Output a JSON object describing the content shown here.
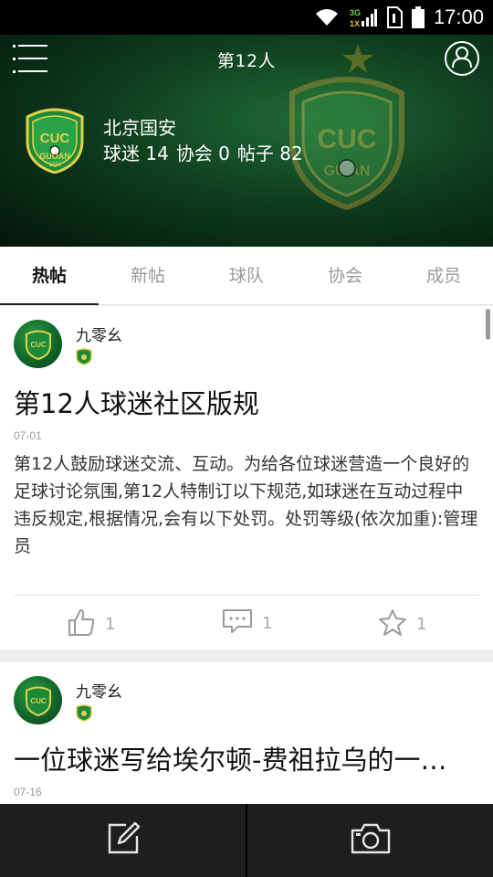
{
  "status_bar": {
    "time": "17:00",
    "network": "3G 1X"
  },
  "header": {
    "title": "第12人",
    "club": {
      "name": "北京国安",
      "stats": [
        {
          "label": "球迷",
          "value": "14"
        },
        {
          "label": "协会",
          "value": "0"
        },
        {
          "label": "帖子",
          "value": "82"
        }
      ],
      "logo_text": "GUOAN",
      "logo_year": "1992"
    }
  },
  "tabs": [
    {
      "label": "热帖",
      "active": true
    },
    {
      "label": "新帖",
      "active": false
    },
    {
      "label": "球队",
      "active": false
    },
    {
      "label": "协会",
      "active": false
    },
    {
      "label": "成员",
      "active": false
    }
  ],
  "posts": [
    {
      "author": "九零幺",
      "title": "第12人球迷社区版规",
      "date": "07-01",
      "body": "第12人鼓励球迷交流、互动。为给各位球迷营造一个良好的足球讨论氛围,第12人特制订以下规范,如球迷在互动过程中违反规定,根据情况,会有以下处罚。处罚等级(依次加重):管理员",
      "likes": "1",
      "comments": "1",
      "favorites": "1"
    },
    {
      "author": "九零幺",
      "title": "一位球迷写给埃尔顿-费祖拉乌的一…",
      "date": "07-16"
    }
  ],
  "colors": {
    "header_green": "#0f3e1e",
    "bottom_bar": "#1e1e1e",
    "accent": "#111111"
  },
  "icons": [
    "menu-icon",
    "profile-icon",
    "like-icon",
    "comment-icon",
    "favorite-icon",
    "compose-icon",
    "camera-icon"
  ]
}
